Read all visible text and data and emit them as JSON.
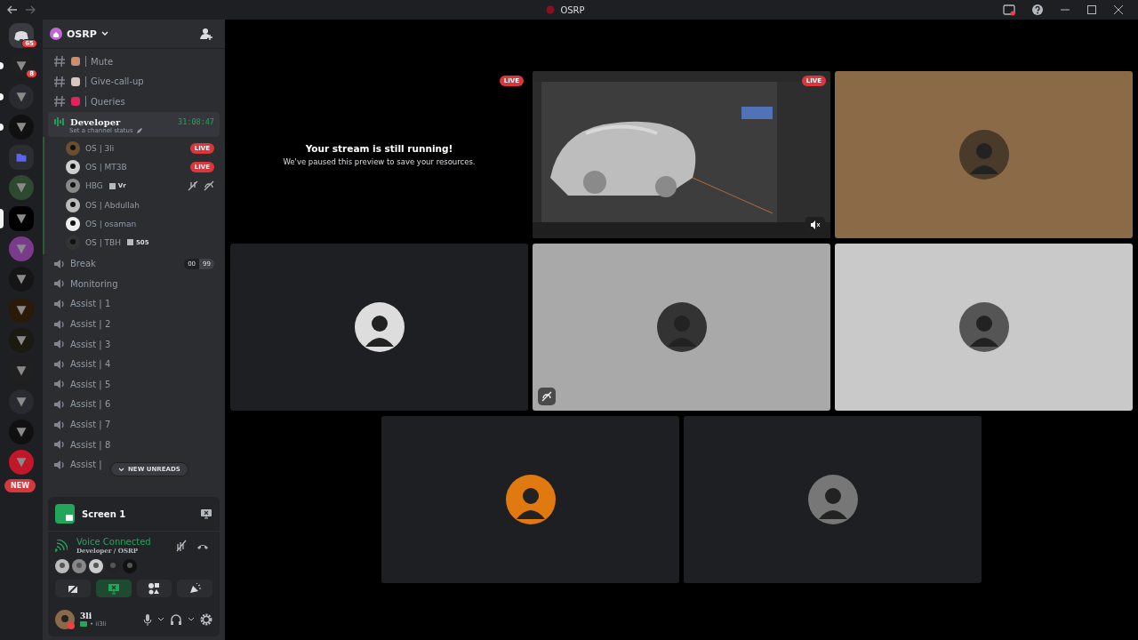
{
  "window": {
    "title": "OSRP"
  },
  "servers": [
    {
      "kind": "home",
      "badge": "65",
      "unread": false,
      "selected": false
    },
    {
      "kind": "server",
      "badge": "8",
      "unread": true,
      "selected": false
    },
    {
      "kind": "server",
      "unread": true,
      "selected": false
    },
    {
      "kind": "server",
      "unread": true,
      "selected": false
    },
    {
      "kind": "folder",
      "unread": false,
      "selected": false
    },
    {
      "kind": "server",
      "unread": false,
      "selected": false
    },
    {
      "kind": "server",
      "unread": false,
      "selected": true
    },
    {
      "kind": "server",
      "unread": false,
      "selected": false
    },
    {
      "kind": "server",
      "unread": false,
      "selected": false
    },
    {
      "kind": "server",
      "unread": false,
      "selected": false
    },
    {
      "kind": "server",
      "unread": false,
      "selected": false
    },
    {
      "kind": "server",
      "unread": false,
      "selected": false
    },
    {
      "kind": "server",
      "unread": false,
      "selected": false
    },
    {
      "kind": "server",
      "unread": false,
      "selected": false
    },
    {
      "kind": "server",
      "unread": false,
      "selected": false
    }
  ],
  "new_pill": "NEW",
  "guild": {
    "name": "OSRP"
  },
  "channels": [
    {
      "kind": "text",
      "name": "Mute"
    },
    {
      "kind": "text",
      "name": "Give-call-up"
    },
    {
      "kind": "text",
      "name": "Queries"
    },
    {
      "kind": "voice",
      "name": "Developer",
      "active": true,
      "timer": "31:08:47",
      "status": "Set a channel status",
      "members": [
        {
          "name": "OS | 3li",
          "badge": "LIVE",
          "muted": false
        },
        {
          "name": "OS | MT3B",
          "badge": "LIVE",
          "muted": false
        },
        {
          "name": "HBG",
          "tag": "Vr",
          "muted": true
        },
        {
          "name": "OS | Abdullah",
          "muted": false
        },
        {
          "name": "OS | osaman",
          "muted": false
        },
        {
          "name": "OS | TBH",
          "tag": "505",
          "muted": false
        }
      ]
    },
    {
      "kind": "voice",
      "name": "Break",
      "counter": [
        "00",
        "99"
      ]
    },
    {
      "kind": "voice",
      "name": "Monitoring"
    },
    {
      "kind": "voice",
      "name": "Assist | 1"
    },
    {
      "kind": "voice",
      "name": "Assist | 2"
    },
    {
      "kind": "voice",
      "name": "Assist | 3"
    },
    {
      "kind": "voice",
      "name": "Assist | 4"
    },
    {
      "kind": "voice",
      "name": "Assist | 5"
    },
    {
      "kind": "voice",
      "name": "Assist | 6"
    },
    {
      "kind": "voice",
      "name": "Assist | 7"
    },
    {
      "kind": "voice",
      "name": "Assist | 8"
    },
    {
      "kind": "voice",
      "name": "Assist |"
    }
  ],
  "new_unreads": "NEW UNREADS",
  "screen_share": {
    "label": "Screen 1"
  },
  "voice": {
    "status": "Voice Connected",
    "location": "Developer / OSRP",
    "actions": [
      {
        "kind": "camera",
        "selected": false
      },
      {
        "kind": "screen",
        "selected": true
      },
      {
        "kind": "activity",
        "selected": false
      },
      {
        "kind": "soundboard",
        "selected": false
      }
    ]
  },
  "user": {
    "name": "3li",
    "tag": "• ii3li"
  },
  "tiles": [
    {
      "kind": "paused",
      "badge": "LIVE",
      "title": "Your stream is still running!",
      "text": "We've paused this preview to save your resources."
    },
    {
      "kind": "stream",
      "badge": "LIVE"
    },
    {
      "kind": "avatar",
      "color": "#8b6a48",
      "deafened": false
    },
    {
      "kind": "avatar",
      "color": "#1e1f22",
      "deafened": false
    },
    {
      "kind": "avatar",
      "color": "#a9a9a9",
      "deafened": true
    },
    {
      "kind": "avatar",
      "color": "#c9c9c9",
      "deafened": false
    },
    {
      "kind": "avatar",
      "color": "#1e1f22",
      "deafened": false
    },
    {
      "kind": "avatar",
      "color": "#1e1f22",
      "deafened": false
    }
  ]
}
